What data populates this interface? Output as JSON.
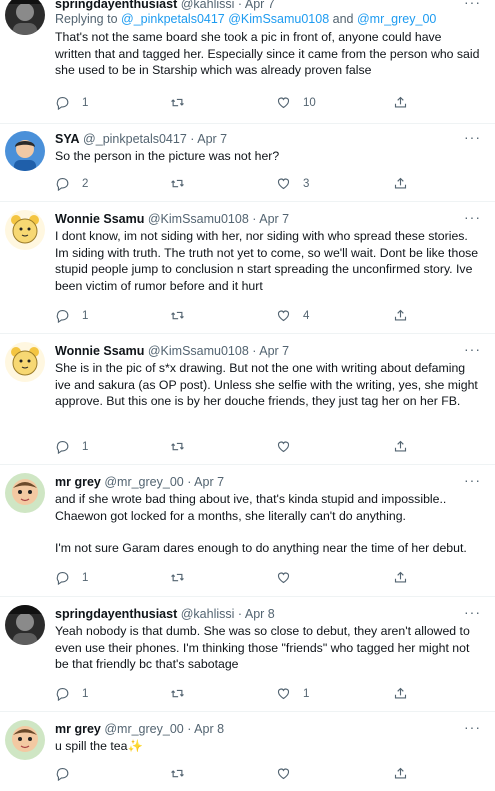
{
  "colors": {
    "link": "#1d9bf0",
    "secondary": "#536471",
    "text": "#0f1419",
    "border": "#eff3f4"
  },
  "tweets": [
    {
      "name": "springdayenthusiast",
      "handle": "@kahlissi",
      "date": "Apr 7",
      "reply_prefix": "Replying to ",
      "reply_users": "@_pinkpetals0417 @KimSsamu0108",
      "reply_and": " and ",
      "reply_user_last": "@mr_grey_00",
      "lines": [
        "That's not the same board she took a pic in front of, anyone could have written that and tagged her. Especially since it came from the person who said she used to be in Starship which was already proven false"
      ],
      "replies": "1",
      "retweets": "",
      "likes": "10",
      "avatar": "avatar-dark-photo"
    },
    {
      "name": "SYA",
      "handle": "@_pinkpetals0417",
      "date": "Apr 7",
      "lines": [
        "So the person in the picture was not her?"
      ],
      "replies": "2",
      "retweets": "",
      "likes": "3",
      "avatar": "avatar-blue-photo"
    },
    {
      "name": "Wonnie Ssamu",
      "handle": "@KimSsamu0108",
      "date": "Apr 7",
      "lines": [
        "I dont know, im not siding with her, nor siding with who spread these stories. Im siding with truth. The truth not yet to come, so we'll wait. Dont be like those stupid people jump to conclusion n start spreading the unconfirmed story. Ive been victim of rumor before and it hurt"
      ],
      "replies": "1",
      "retweets": "",
      "likes": "4",
      "avatar": "avatar-cartoon-bear"
    },
    {
      "name": "Wonnie Ssamu",
      "handle": "@KimSsamu0108",
      "date": "Apr 7",
      "lines": [
        "She is in the pic of s*x drawing. But not the one with writing about defaming ive and sakura (as OP post). Unless she selfie with the writing, yes, she might approve. But this one is by her douche friends, they just tag her on her FB."
      ],
      "replies": "1",
      "retweets": "",
      "likes": "",
      "avatar": "avatar-cartoon-bear"
    },
    {
      "name": "mr grey",
      "handle": "@mr_grey_00",
      "date": "Apr 7",
      "lines": [
        "and if she wrote bad thing about ive, that's kinda stupid and impossible.. Chaewon got locked for a months, she literally can't do anything.",
        "I'm not sure Garam dares enough to do anything near the time of her debut."
      ],
      "replies": "1",
      "retweets": "",
      "likes": "",
      "avatar": "avatar-cartoon-kid"
    },
    {
      "name": "springdayenthusiast",
      "handle": "@kahlissi",
      "date": "Apr 8",
      "lines": [
        "Yeah nobody is that dumb. She was so close to debut, they aren't allowed to even use their phones. I'm thinking those \"friends\" who tagged her might not be that friendly bc that's sabotage"
      ],
      "replies": "1",
      "retweets": "",
      "likes": "1",
      "avatar": "avatar-dark-photo"
    },
    {
      "name": "mr grey",
      "handle": "@mr_grey_00",
      "date": "Apr 8",
      "lines": [
        "u spill the tea"
      ],
      "emoji": "✨",
      "replies": "",
      "retweets": "",
      "likes": "",
      "avatar": "avatar-cartoon-kid"
    }
  ]
}
